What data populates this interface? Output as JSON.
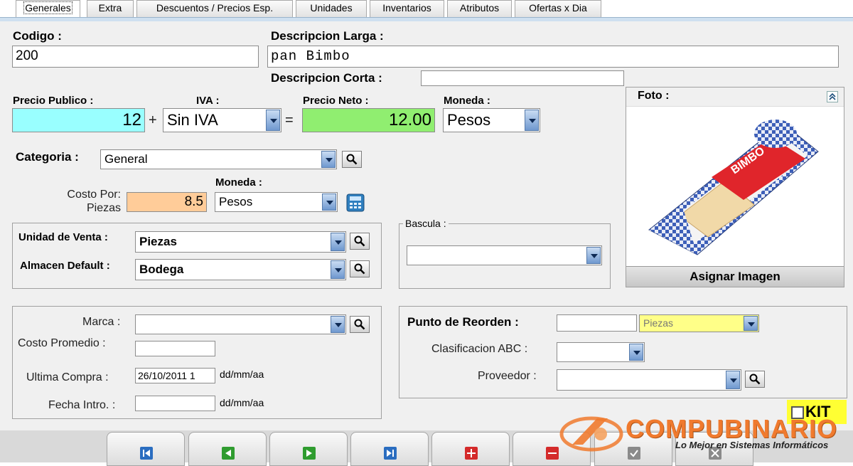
{
  "tabs": [
    {
      "label": "Generales",
      "active": true
    },
    {
      "label": "Extra"
    },
    {
      "label": "Descuentos / Precios Esp."
    },
    {
      "label": "Unidades"
    },
    {
      "label": "Inventarios"
    },
    {
      "label": "Atributos"
    },
    {
      "label": "Ofertas x Dia"
    }
  ],
  "product": {
    "codigo_label": "Codigo :",
    "codigo_value": "200",
    "desc_larga_label": "Descripcion Larga :",
    "desc_larga_value": "pan Bimbo",
    "desc_corta_label": "Descripcion Corta :",
    "desc_corta_value": ""
  },
  "pricing": {
    "precio_publico_label": "Precio Publico :",
    "precio_publico_value": "12",
    "plus": "+",
    "iva_label": "IVA :",
    "iva_value": "Sin IVA",
    "equals": "=",
    "precio_neto_label": "Precio Neto :",
    "precio_neto_value": "12.00",
    "moneda_label": "Moneda :",
    "moneda_value": "Pesos",
    "colors": {
      "publico_bg": "#99ffff",
      "neto_bg": "#90ee70",
      "costo_bg": "#ffcc99"
    }
  },
  "categoria": {
    "label": "Categoria :",
    "value": "General"
  },
  "costo": {
    "label": "Costo Por: Piezas",
    "value": "8.5",
    "moneda_label": "Moneda :",
    "moneda_value": "Pesos"
  },
  "venta": {
    "unidad_label": "Unidad de Venta :",
    "unidad_value": "Piezas",
    "almacen_label": "Almacen Default :",
    "almacen_value": "Bodega"
  },
  "bascula": {
    "label": "Bascula :",
    "value": ""
  },
  "foto": {
    "label": "Foto :",
    "asignar_label": "Asignar Imagen"
  },
  "extra": {
    "marca_label": "Marca :",
    "marca_value": "",
    "costo_prom_label": "Costo Promedio :",
    "costo_prom_value": "",
    "ultima_compra_label": "Ultima Compra :",
    "ultima_compra_value": "26/10/2011 1",
    "date_fmt": "dd/mm/aa",
    "fecha_intro_label": "Fecha Intro. :",
    "fecha_intro_value": ""
  },
  "reorden": {
    "label": "Punto de Reorden :",
    "value": "",
    "unit_value": "Piezas",
    "clasif_label": "Clasificacion ABC :",
    "clasif_value": "",
    "proveedor_label": "Proveedor :",
    "proveedor_value": ""
  },
  "kit_label": "KIT",
  "nav_buttons": [
    "first-icon",
    "previous-icon",
    "next-icon",
    "last-icon",
    "add-icon",
    "delete-icon",
    "accept-icon",
    "cancel-icon"
  ],
  "brand": {
    "name": "COMPUBINARIO",
    "tagline": "Lo Mejor en Sistemas Informáticos"
  }
}
